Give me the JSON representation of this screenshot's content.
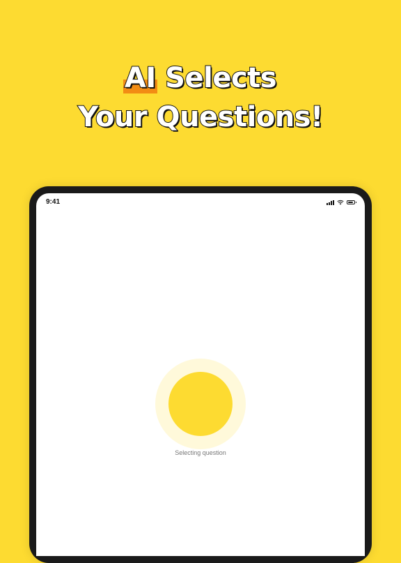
{
  "headline": {
    "highlight_word": "AI",
    "line1_rest": "Selects",
    "line2": "Your Questions!"
  },
  "status_bar": {
    "time": "9:41"
  },
  "loader": {
    "caption": "Selecting question"
  },
  "colors": {
    "background": "#FDDB31",
    "highlight": "#F28C14",
    "loader_core": "#FDDB31",
    "loader_ring": "#FFF9DA",
    "device_frame": "#1A1A1A"
  },
  "icons": [
    "signal-icon",
    "wifi-icon",
    "battery-icon"
  ]
}
